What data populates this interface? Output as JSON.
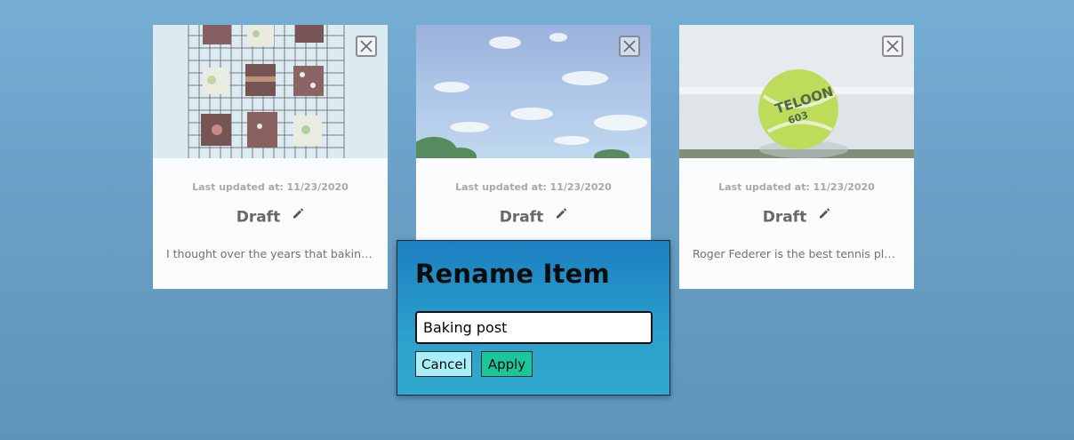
{
  "cards": [
    {
      "image": "brownies-on-cooling-rack",
      "updated": "Last updated at: 11/23/2020",
      "title": "Draft",
      "excerpt": "I thought over the years that baking …"
    },
    {
      "image": "blue-sky-with-clouds-and-trees",
      "updated": "Last updated at: 11/23/2020",
      "title": "Draft",
      "excerpt": ""
    },
    {
      "image": "tennis-ball-on-court",
      "updated": "Last updated at: 11/23/2020",
      "title": "Draft",
      "excerpt": "Roger Federer is the best tennis play…"
    }
  ],
  "modal": {
    "title": "Rename Item",
    "input_value": "Baking post",
    "cancel_label": "Cancel",
    "apply_label": "Apply"
  },
  "colors": {
    "background": "#6fa6cd",
    "modal_gradient_top": "#1b7fc0",
    "modal_gradient_bottom": "#31a9cd",
    "cancel_button": "#aaeef9",
    "apply_button": "#1bc79a"
  },
  "icons": {
    "close": "close-icon",
    "edit": "pencil-icon"
  }
}
